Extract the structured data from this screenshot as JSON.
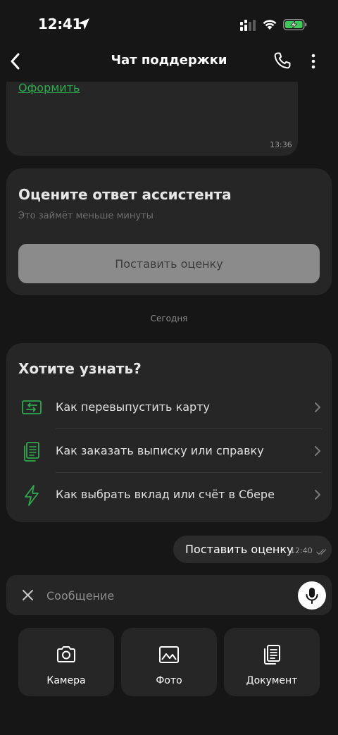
{
  "status_bar": {
    "time": "12:41"
  },
  "header": {
    "title": "Чат поддержки"
  },
  "top_message": {
    "link_text": "Оформить",
    "time": "13:36"
  },
  "rating_card": {
    "title": "Оцените ответ ассистента",
    "subtitle": "Это займёт меньше минуты",
    "button_label": "Поставить оценку"
  },
  "date_separator": "Сегодня",
  "faq_card": {
    "title": "Хотите узнать?",
    "items": [
      {
        "label": "Как перевыпустить карту",
        "icon": "card-reissue-icon"
      },
      {
        "label": "Как заказать выписку или справку",
        "icon": "documents-icon"
      },
      {
        "label": "Как выбрать вклад или счёт в Сбере",
        "icon": "lightning-icon"
      }
    ]
  },
  "user_message": {
    "text": "Поставить оценку",
    "time": "12:40"
  },
  "input": {
    "placeholder": "Сообщение",
    "value": ""
  },
  "attach": {
    "camera": "Камера",
    "photo": "Фото",
    "document": "Документ"
  },
  "colors": {
    "background": "#161616",
    "card": "#262626",
    "accent_green": "#2fa84f",
    "muted_text": "#8d8d8d"
  }
}
